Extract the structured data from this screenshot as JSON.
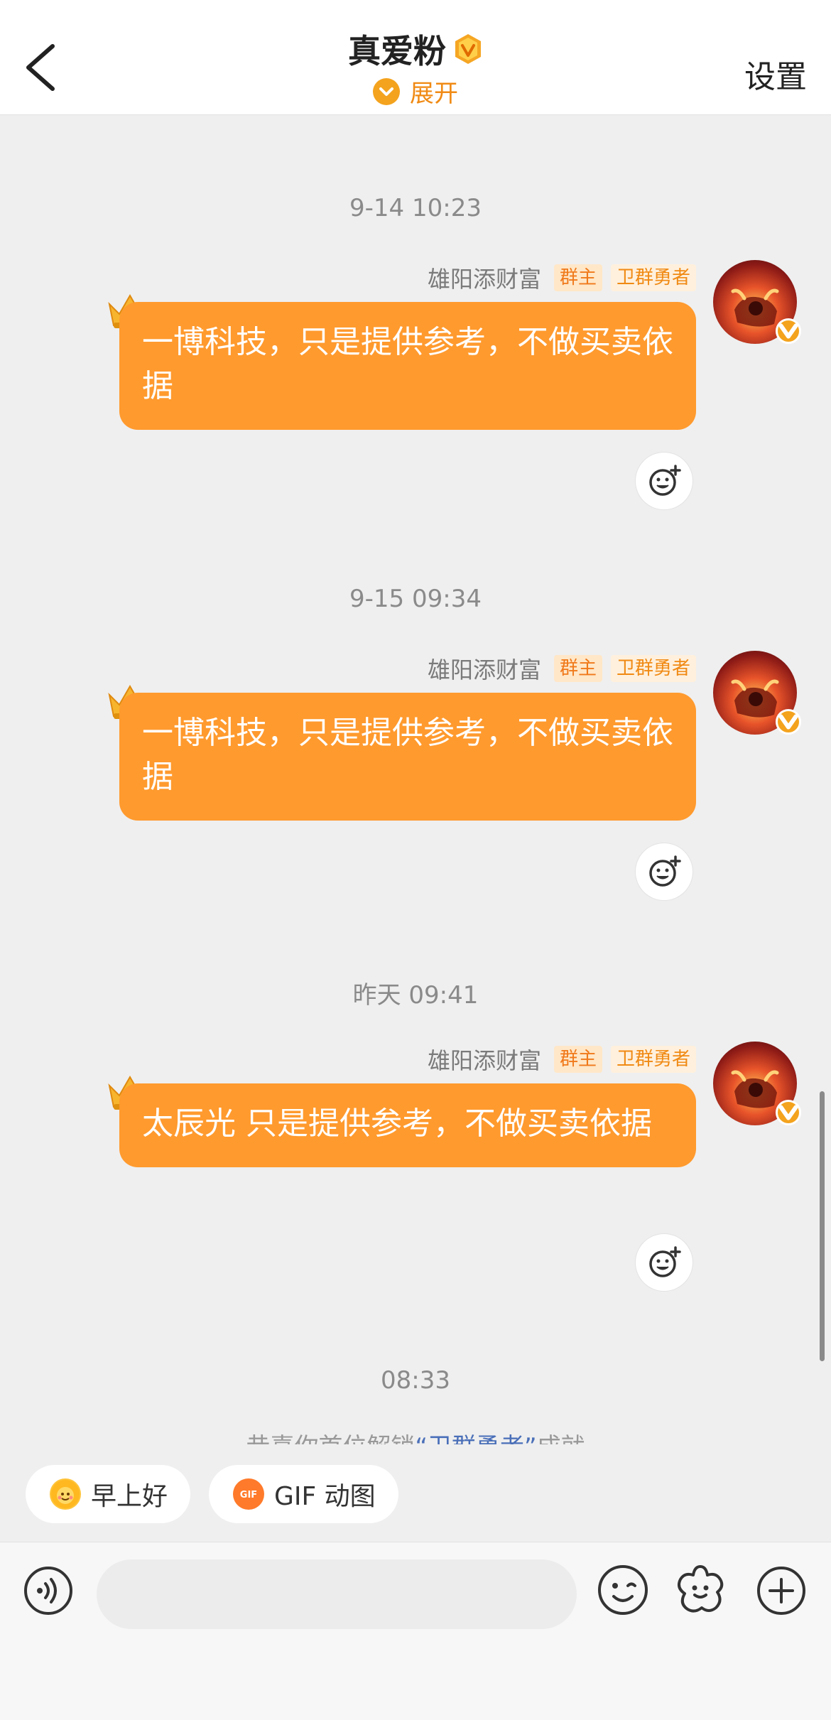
{
  "header": {
    "back_icon": "chevron-left-icon",
    "title": "真爱粉",
    "vip_badge_icon": "vip-v-badge-icon",
    "expand_label": "展开",
    "settings_label": "设置"
  },
  "messages": [
    {
      "timestamp": "9-14 10:23",
      "sender": "雄阳添财富",
      "tags": [
        "群主",
        "卫群勇者"
      ],
      "text": "一博科技，只是提供参考，不做买卖依据"
    },
    {
      "timestamp": "9-15 09:34",
      "sender": "雄阳添财富",
      "tags": [
        "群主",
        "卫群勇者"
      ],
      "text": "一博科技，只是提供参考，不做买卖依据"
    },
    {
      "timestamp": "昨天 09:41",
      "sender": "雄阳添财富",
      "tags": [
        "群主",
        "卫群勇者"
      ],
      "text": "太辰光 只是提供参考，不做买卖依据"
    }
  ],
  "last_timestamp": "08:33",
  "system_message": {
    "prefix": "恭喜你首位解锁",
    "highlight": "“卫群勇者”",
    "suffix": "成就"
  },
  "quick_replies": [
    {
      "label": "早上好",
      "icon": "sun-face-icon"
    },
    {
      "label": "GIF 动图",
      "icon": "gif-icon"
    }
  ],
  "input": {
    "placeholder": "",
    "icons": [
      "voice-icon",
      "emoji-icon",
      "sticker-icon",
      "plus-icon"
    ]
  },
  "colors": {
    "bubble": "#ff9a2e",
    "accent": "#f08a14",
    "background": "#efefef"
  }
}
